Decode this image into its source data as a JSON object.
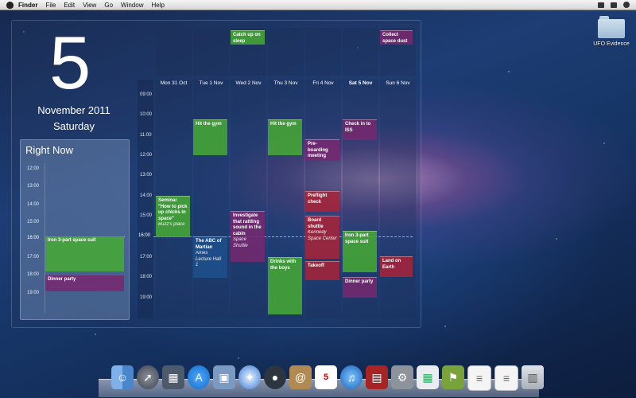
{
  "menubar": {
    "app": "Finder",
    "items": [
      "File",
      "Edit",
      "View",
      "Go",
      "Window",
      "Help"
    ]
  },
  "today": {
    "day": "5",
    "month_year": "November 2011",
    "weekday": "Saturday"
  },
  "right_now": {
    "title": "Right Now",
    "times": [
      "12:00",
      "13:00",
      "14:00",
      "15:00",
      "16:00",
      "17:00",
      "18:00",
      "19:00"
    ],
    "events": [
      {
        "title": "Iron 3-part space suit"
      },
      {
        "title": "Dinner party"
      }
    ]
  },
  "week": {
    "times": [
      "09:00",
      "10:00",
      "11:00",
      "12:00",
      "13:00",
      "14:00",
      "15:00",
      "16:00",
      "17:00",
      "18:00",
      "19:00"
    ],
    "days": [
      {
        "label": "Mon 31 Oct"
      },
      {
        "label": "Tue 1 Nov"
      },
      {
        "label": "Wed 2 Nov"
      },
      {
        "label": "Thu 3 Nov"
      },
      {
        "label": "Fri 4 Nov"
      },
      {
        "label": "Sat 5 Nov"
      },
      {
        "label": "Sun 6 Nov"
      }
    ],
    "all_day": {
      "wed": "Catch up on sleep",
      "sun": "Collect space dust"
    },
    "events": {
      "seminar": {
        "title": "Seminar \"How to pick up chicks in space\"",
        "location": "Buzz's place"
      },
      "gym_tue": {
        "title": "Hit the gym"
      },
      "abc_martian": {
        "title": "The ABC of Martian",
        "location": "Ames Lecture Hall 1"
      },
      "investigate": {
        "title": "Investigate that rattling sound in the cabin",
        "location": "Space Shuttle"
      },
      "gym_thu": {
        "title": "Hit the gym"
      },
      "drinks": {
        "title": "Drinks with the boys"
      },
      "preboarding": {
        "title": "Pre-boarding meeting"
      },
      "preflight": {
        "title": "Preflight check"
      },
      "board_shuttle": {
        "title": "Board shuttle",
        "location": "Kennedy Space Center"
      },
      "takeoff": {
        "title": "Takeoff"
      },
      "checkin": {
        "title": "Check in to ISS"
      },
      "iron_suit": {
        "title": "Iron 3-part space suit"
      },
      "dinner": {
        "title": "Dinner party"
      },
      "land": {
        "title": "Land on Earth"
      }
    },
    "now_time": "16:00"
  },
  "desktop": {
    "folder_label": "UFO Evidence"
  },
  "dock": {
    "calendar_day": "5",
    "icons": [
      "finder-icon",
      "launchpad-icon",
      "mission-control-icon",
      "app-store-icon",
      "preview-icon",
      "safari-icon",
      "facetime-icon",
      "address-book-icon",
      "ical-icon",
      "itunes-icon",
      "photo-booth-icon",
      "system-preferences-icon",
      "calendar-widget-icon",
      "utilities-icon",
      "document-icon",
      "document2-icon",
      "trash-icon"
    ]
  }
}
